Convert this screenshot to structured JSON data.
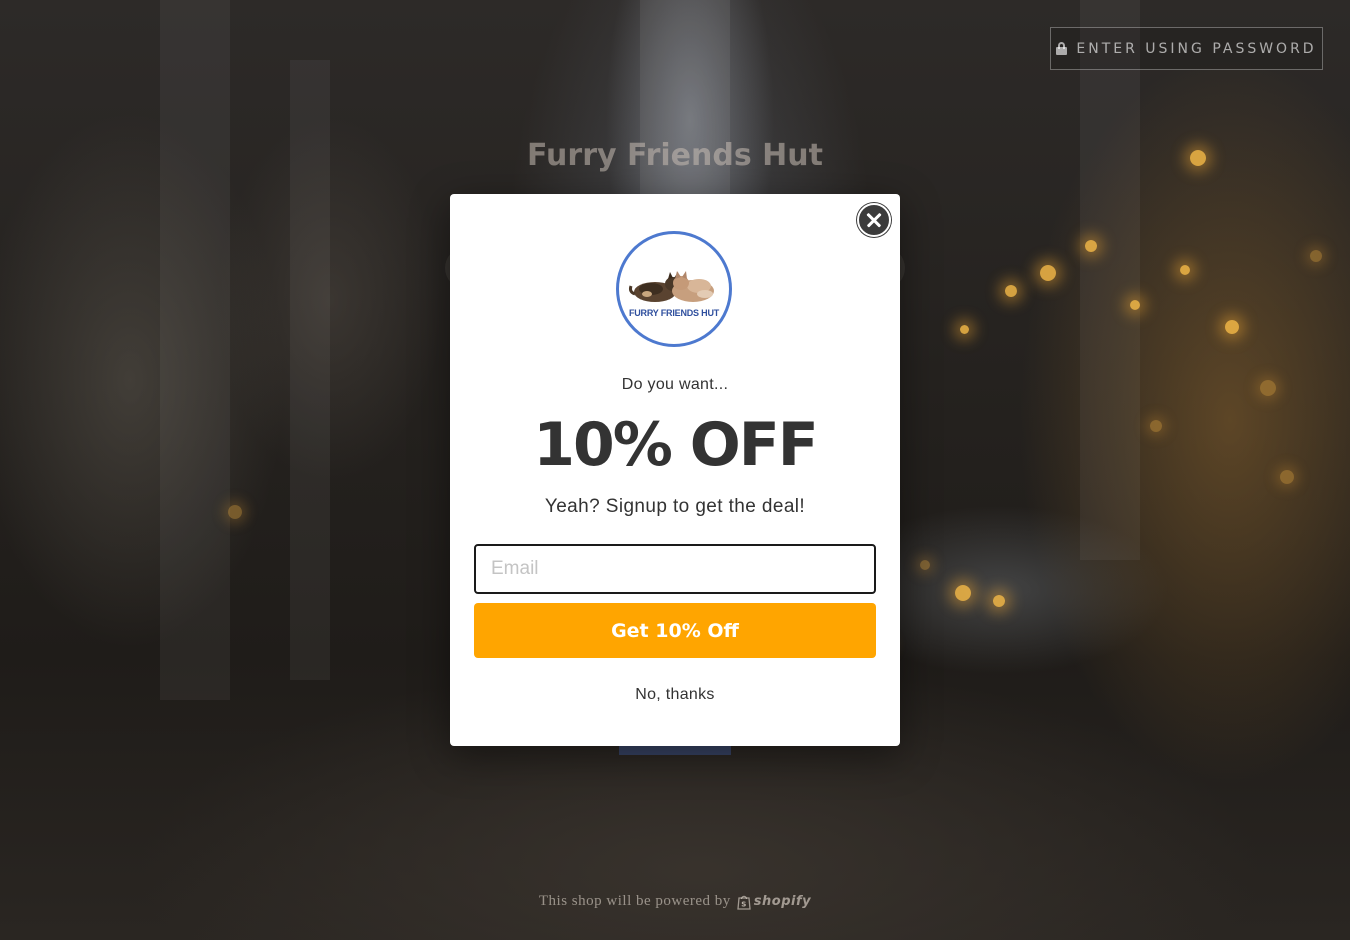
{
  "header": {
    "password_button_label": "ENTER USING PASSWORD",
    "lock_icon": "lock-icon"
  },
  "store": {
    "name": "Furry Friends Hut"
  },
  "popup": {
    "logo_text": "FURRY FRIENDS HUT",
    "prompt": "Do you want...",
    "headline": "10% OFF",
    "subtext": "Yeah? Signup to get the deal!",
    "email_placeholder": "Email",
    "email_value": "",
    "cta_label": "Get 10% Off",
    "decline_label": "No, thanks",
    "close_icon": "close-icon"
  },
  "footer": {
    "powered_by_text": "This shop will be powered by",
    "brand_name": "shopify"
  },
  "colors": {
    "cta_background": "#ffa500",
    "logo_ring": "#4d79cf",
    "headline_text": "#333333",
    "close_button": "#3b3b3b"
  }
}
